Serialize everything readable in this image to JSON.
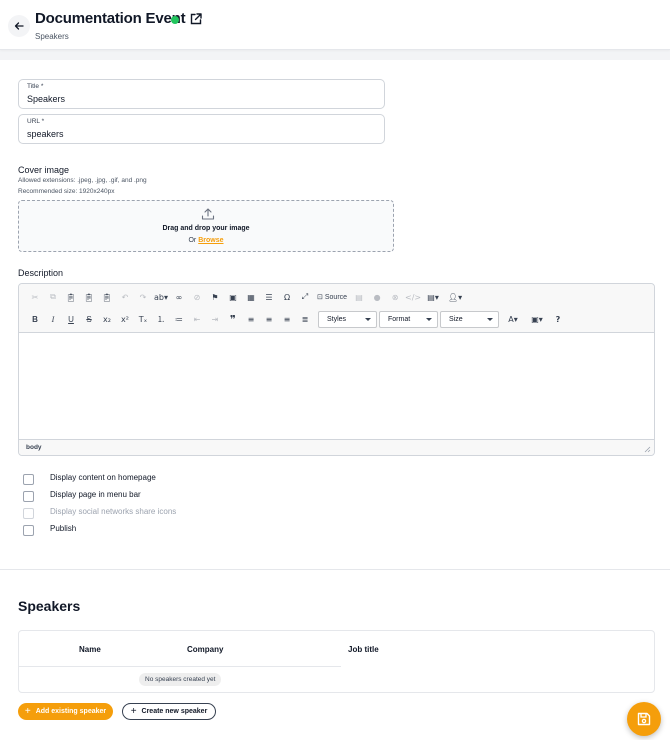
{
  "header": {
    "title": "Documentation Event",
    "breadcrumb": "Speakers",
    "status_color": "#22c55e"
  },
  "form": {
    "title_label": "Title *",
    "title_value": "Speakers",
    "url_label": "URL *",
    "url_value": "speakers"
  },
  "cover": {
    "label": "Cover image",
    "extensions": "Allowed extensions: .jpeg, .jpg, .gif, and .png",
    "size": "Recommended size: 1920x240px",
    "drag_text": "Drag and drop your image",
    "or_text": "Or",
    "browse_label": "Browse"
  },
  "description": {
    "label": "Description",
    "toolbar": {
      "source_label": "Source",
      "styles_label": "Styles",
      "format_label": "Format",
      "size_label": "Size"
    },
    "status_path": "body"
  },
  "options": [
    {
      "label": "Display content on homepage",
      "checked": false,
      "disabled": false
    },
    {
      "label": "Display page in menu bar",
      "checked": false,
      "disabled": false
    },
    {
      "label": "Display social networks share icons",
      "checked": false,
      "disabled": true
    },
    {
      "label": "Publish",
      "checked": false,
      "disabled": false
    }
  ],
  "speakers": {
    "title": "Speakers",
    "columns": [
      "Name",
      "Company",
      "Job title"
    ],
    "empty_text": "No speakers created yet",
    "add_existing_label": "Add existing speaker",
    "create_new_label": "Create new speaker"
  },
  "colors": {
    "accent": "#f59e0b"
  }
}
